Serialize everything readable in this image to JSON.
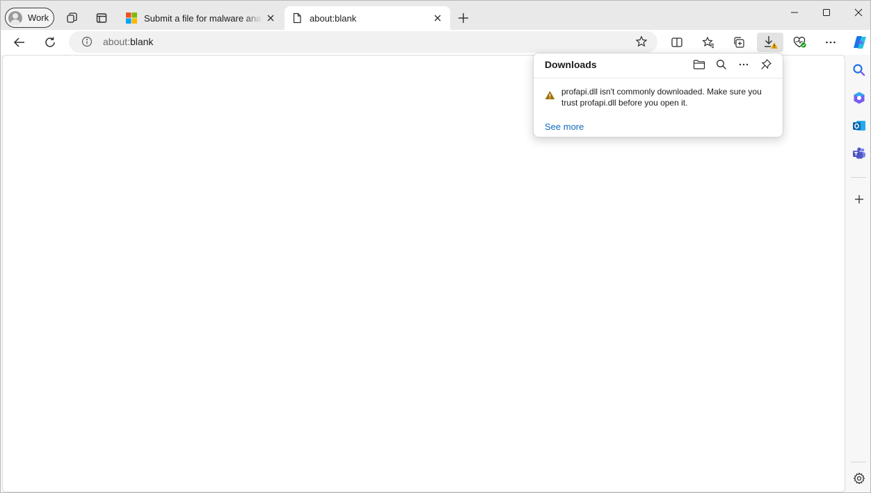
{
  "profile": {
    "label": "Work"
  },
  "tabs": [
    {
      "title": "Submit a file for malware analysis",
      "favicon": "microsoft-logo"
    },
    {
      "title": "about:blank",
      "favicon": "page-icon",
      "active": true
    }
  ],
  "address": {
    "url_scheme": "about:",
    "url_rest": "blank"
  },
  "downloads": {
    "title": "Downloads",
    "message": "profapi.dll isn't commonly downloaded. Make sure you trust profapi.dll before you open it.",
    "see_more": "See more"
  },
  "colors": {
    "accent_link": "#0f6cbd",
    "warning": "#a07000",
    "ms_red": "#f25022",
    "ms_green": "#7fba00",
    "ms_blue": "#00a4ef",
    "ms_yellow": "#ffb900"
  }
}
